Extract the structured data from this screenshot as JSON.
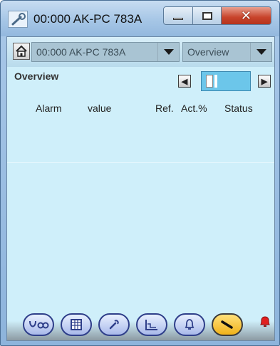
{
  "window": {
    "title": "00:000 AK-PC 783A",
    "icon": "wrench-app-icon",
    "buttons": [
      "minimize",
      "maximize",
      "close"
    ]
  },
  "toolbar": {
    "device_select": "00:000 AK-PC 783A",
    "view_select": "Overview"
  },
  "section": {
    "title": "Overview"
  },
  "pager": {
    "prev_icon": "minus-icon",
    "next_icon": "plus-icon"
  },
  "table": {
    "columns": [
      "Alarm",
      "value",
      "Ref.",
      "Act.%",
      "Status"
    ],
    "rows": []
  },
  "bottom_nav": {
    "items": [
      {
        "icon": "overview-icon",
        "active": false
      },
      {
        "icon": "table-icon",
        "active": false
      },
      {
        "icon": "tools-icon",
        "active": false
      },
      {
        "icon": "trend-icon",
        "active": false
      },
      {
        "icon": "bell-outline-icon",
        "active": false
      },
      {
        "icon": "service-wrench-icon",
        "active": true
      }
    ],
    "alarm_indicator": "red-bell-icon",
    "colors": {
      "active": "#f0b21a",
      "alarm": "#e02020",
      "panel": "#cfeffa"
    }
  }
}
